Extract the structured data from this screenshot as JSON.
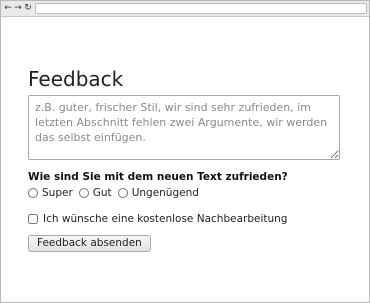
{
  "browser": {
    "back_icon": "back-arrow-icon",
    "forward_icon": "forward-arrow-icon",
    "reload_icon": "reload-icon",
    "back_glyph": "←",
    "forward_glyph": "→",
    "reload_glyph": "↻",
    "address": ""
  },
  "form": {
    "title": "Feedback",
    "textarea_value": "",
    "textarea_placeholder": "z.B. guter, frischer Stil, wir sind sehr zufrieden, im letzten Abschnitt fehlen zwei Argumente, wir werden das selbst einfügen.",
    "question": "Wie sind Sie mit dem neuen Text zufrieden?",
    "options": [
      {
        "label": "Super",
        "checked": false
      },
      {
        "label": "Gut",
        "checked": false
      },
      {
        "label": "Ungenügend",
        "checked": false
      }
    ],
    "checkbox_label": "Ich wünsche eine kostenlose Nachbearbeitung",
    "checkbox_checked": false,
    "submit_label": "Feedback absenden"
  }
}
